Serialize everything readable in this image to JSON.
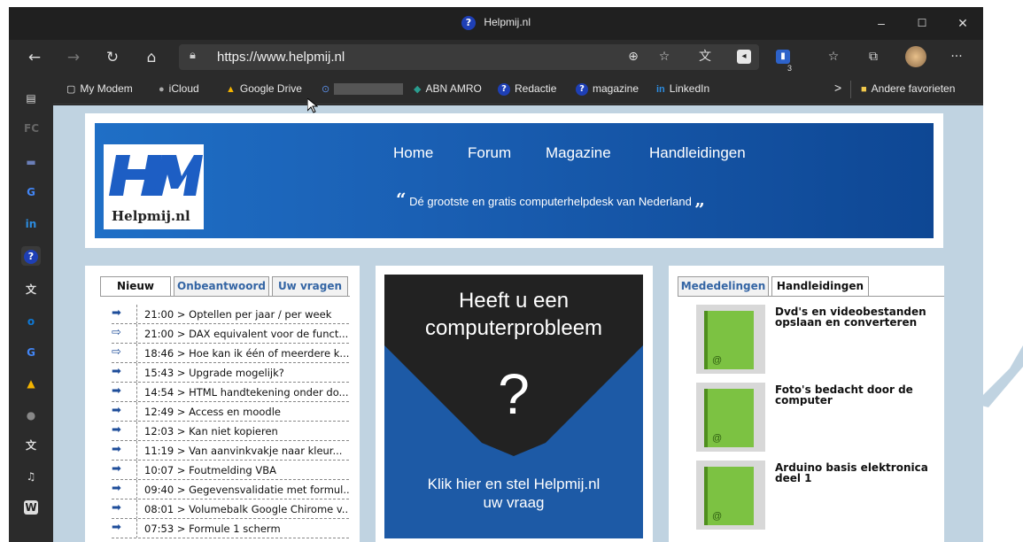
{
  "window": {
    "title": "Helpmij.nl",
    "controls": [
      "–",
      "☐",
      "✕"
    ]
  },
  "navbar": {
    "url": "https://www.helpmij.nl",
    "ext_badge": "3"
  },
  "bookmarks": {
    "items": [
      {
        "label": "My Modem",
        "icon": "page-icon"
      },
      {
        "label": "iCloud",
        "icon": "apple-icon"
      },
      {
        "label": "Google Drive",
        "icon": "drive-icon"
      },
      {
        "label": "",
        "icon": "lock-icon"
      },
      {
        "label": "ABN AMRO",
        "icon": "abnamro-icon"
      },
      {
        "label": "Redactie",
        "icon": "helpmij-icon"
      },
      {
        "label": "magazine",
        "icon": "helpmij-icon"
      },
      {
        "label": "LinkedIn",
        "icon": "linkedin-icon"
      }
    ],
    "overflow": ">",
    "other": "Andere favorieten"
  },
  "site": {
    "logo_text": "Helpmij.nl",
    "nav": [
      "Home",
      "Forum",
      "Magazine",
      "Handleidingen"
    ],
    "tagline": "Dé grootste en gratis computerhelpdesk van Nederland",
    "quote_open": "“",
    "quote_close": "„"
  },
  "left": {
    "tabs": [
      "Nieuw",
      "Onbeantwoord",
      "Uw vragen"
    ],
    "posts": [
      {
        "text": "21:00 > Optellen per jaar / per week",
        "icon": "arrow-filled"
      },
      {
        "text": "21:00 > DAX equivalent voor de funct...",
        "icon": "arrow-outline"
      },
      {
        "text": "18:46 > Hoe kan ik één of meerdere k...",
        "icon": "arrow-outline"
      },
      {
        "text": "15:43 > Upgrade mogelijk?",
        "icon": "arrow-filled"
      },
      {
        "text": "14:54 > HTML handtekening onder do...",
        "icon": "arrow-filled"
      },
      {
        "text": "12:49 > Access en moodle",
        "icon": "arrow-filled"
      },
      {
        "text": "12:03 > Kan niet kopieren",
        "icon": "arrow-filled"
      },
      {
        "text": "11:19 > Van aanvinkvakje naar kleur...",
        "icon": "arrow-filled"
      },
      {
        "text": "10:07 > Foutmelding VBA",
        "icon": "arrow-filled"
      },
      {
        "text": "09:40 > Gegevensvalidatie met formul...",
        "icon": "arrow-filled"
      },
      {
        "text": "08:01 > Volumebalk Google Chirome v...",
        "icon": "arrow-filled"
      },
      {
        "text": "07:53 > Formule 1 scherm",
        "icon": "arrow-filled"
      }
    ]
  },
  "ad": {
    "headline_1": "Heeft u een",
    "headline_2": "computerprobleem",
    "question": "?",
    "cta_1": "Klik hier en stel Helpmij.nl",
    "cta_2": "uw vraag"
  },
  "right": {
    "tabs": [
      "Mededelingen",
      "Handleidingen"
    ],
    "guides": [
      {
        "line1": "Dvd's en videobestanden",
        "line2": "opslaan en converteren"
      },
      {
        "line1": "Foto's bedacht door de",
        "line2": "computer"
      },
      {
        "line1": "Arduino basis elektronica",
        "line2": "deel 1"
      }
    ]
  },
  "colors": {
    "accent": "#1a5fb3",
    "page_bg": "#c0d3e1",
    "book_green": "#7cc242",
    "link_blue": "#3465a4"
  }
}
